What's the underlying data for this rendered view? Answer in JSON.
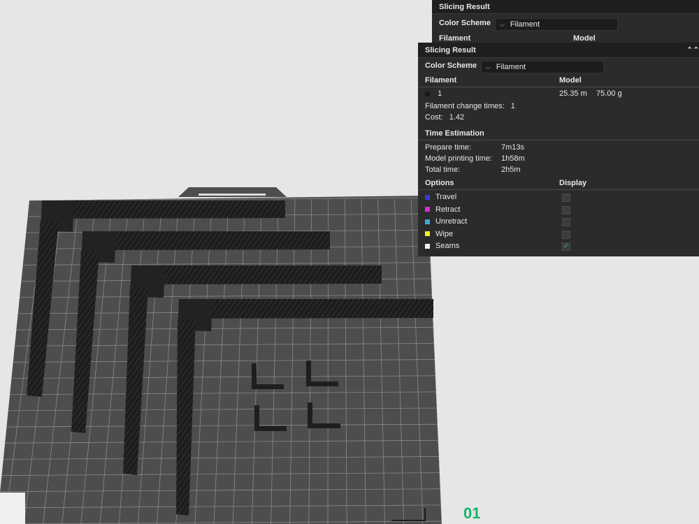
{
  "panel_back": {
    "title": "Slicing Result",
    "color_scheme_label": "Color Scheme",
    "color_scheme_value": "Filament",
    "filament_header": "Filament",
    "model_header": "Model"
  },
  "panel": {
    "title": "Slicing Result",
    "color_scheme_label": "Color Scheme",
    "color_scheme_value": "Filament",
    "filament_header": "Filament",
    "model_header": "Model",
    "filament_id": "1",
    "filament_length": "25.35 m",
    "filament_weight": "75.00 g",
    "filament_change_label": "Filament change times:",
    "filament_change_value": "1",
    "cost_label": "Cost:",
    "cost_value": "1.42",
    "time_header": "Time Estimation",
    "prepare_label": "Prepare time:",
    "prepare_value": "7m13s",
    "model_time_label": "Model printing time:",
    "model_time_value": "1h58m",
    "total_label": "Total time:",
    "total_value": "2h5m",
    "options_header": "Options",
    "display_header": "Display",
    "options": [
      {
        "label": "Travel",
        "color": "#3b3bd6",
        "checked": false
      },
      {
        "label": "Retract",
        "color": "#d62fd6",
        "checked": false
      },
      {
        "label": "Unretract",
        "color": "#3fa7d6",
        "checked": false
      },
      {
        "label": "Wipe",
        "color": "#f2f21d",
        "checked": false
      },
      {
        "label": "Seams",
        "color": "#f0f0f0",
        "checked": true
      }
    ]
  },
  "layer_indicator": "01",
  "colors": {
    "bed": "#4d4d4d",
    "grid": "#8a8a8a",
    "print": "#1e1e1e",
    "background": "#e6e6e6"
  }
}
